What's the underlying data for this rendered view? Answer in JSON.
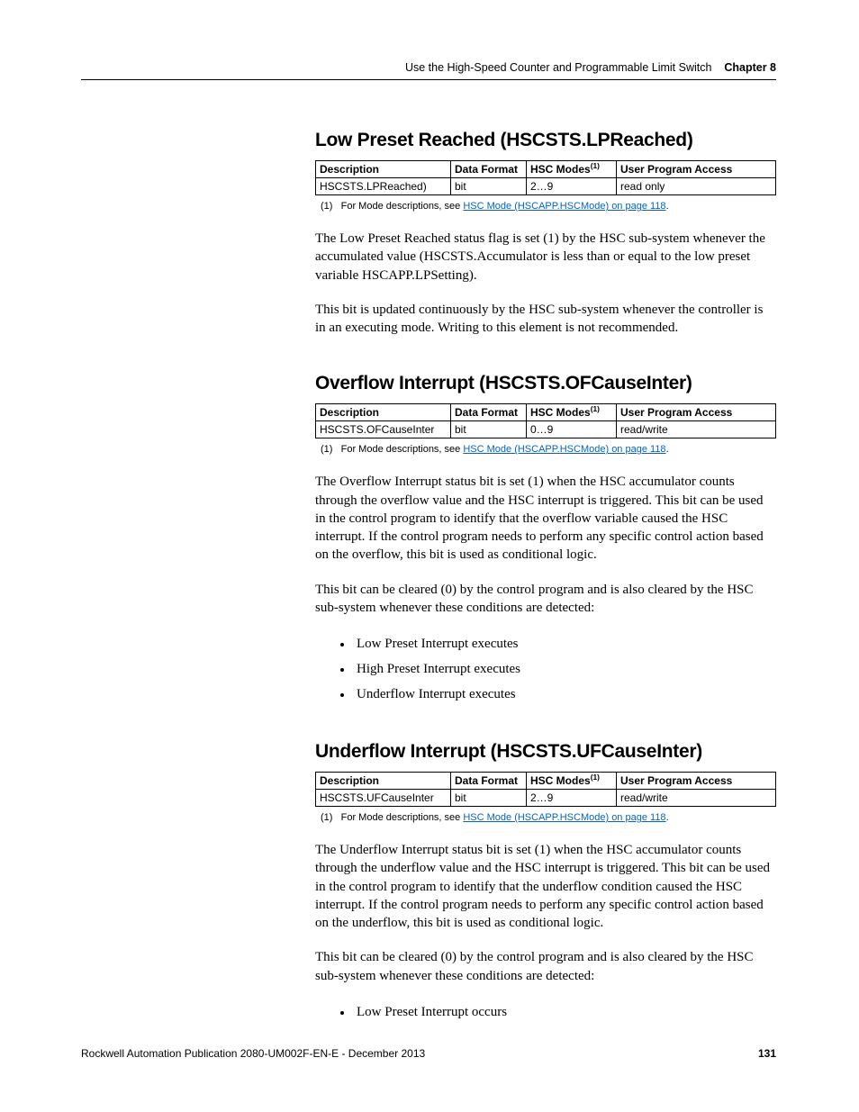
{
  "header": {
    "text_before": "Use the High-Speed Counter and Programmable Limit Switch",
    "chapter": "Chapter 8"
  },
  "sections": [
    {
      "heading": "Low Preset Reached (HSCSTS.LPReached)",
      "table": {
        "headers": {
          "c1": "Description",
          "c2": "Data Format",
          "c3_pre": "HSC Modes",
          "c3_sup": "(1)",
          "c4": "User Program Access"
        },
        "row": {
          "c1": "HSCSTS.LPReached)",
          "c2": "bit",
          "c3": "2…9",
          "c4": "read only"
        }
      },
      "footnote": {
        "prefix": "(1)   For Mode descriptions, see ",
        "link": "HSC Mode (HSCAPP.HSCMode) on page 118",
        "suffix": "."
      },
      "paras": [
        "The Low Preset Reached status flag is set (1) by the HSC sub-system whenever the accumulated value (HSCSTS.Accumulator is less than or equal to the low preset variable HSCAPP.LPSetting).",
        "This bit is updated continuously by the HSC sub-system whenever the controller is in an executing mode. Writing to this element is not recommended."
      ]
    },
    {
      "heading": "Overflow Interrupt (HSCSTS.OFCauseInter)",
      "table": {
        "headers": {
          "c1": "Description",
          "c2": "Data Format",
          "c3_pre": "HSC Modes",
          "c3_sup": "(1)",
          "c4": "User Program Access"
        },
        "row": {
          "c1": "HSCSTS.OFCauseInter",
          "c2": "bit",
          "c3": "0…9",
          "c4": "read/write"
        }
      },
      "footnote": {
        "prefix": "(1)   For Mode descriptions, see ",
        "link": "HSC Mode (HSCAPP.HSCMode) on page 118",
        "suffix": "."
      },
      "paras": [
        "The Overflow Interrupt status bit is set (1) when the HSC accumulator counts through the overflow value and the HSC interrupt is triggered. This bit can be used in the control program to identify that the overflow variable caused the HSC interrupt. If the control program needs to perform any specific control action based on the overflow, this bit is used as conditional logic.",
        "This bit can be cleared (0) by the control program and is also cleared by the HSC sub-system whenever these conditions are detected:"
      ],
      "list": [
        "Low Preset Interrupt executes",
        "High Preset Interrupt executes",
        "Underflow Interrupt executes"
      ]
    },
    {
      "heading": "Underflow Interrupt (HSCSTS.UFCauseInter)",
      "table": {
        "headers": {
          "c1": "Description",
          "c2": "Data Format",
          "c3_pre": "HSC Modes",
          "c3_sup": "(1)",
          "c4": "User Program Access"
        },
        "row": {
          "c1": "HSCSTS.UFCauseInter",
          "c2": "bit",
          "c3": "2…9",
          "c4": "read/write"
        }
      },
      "footnote": {
        "prefix": "(1)   For Mode descriptions, see ",
        "link": "HSC Mode (HSCAPP.HSCMode) on page 118",
        "suffix": "."
      },
      "paras": [
        "The Underflow Interrupt status bit is set (1) when the HSC accumulator counts through the underflow value and the HSC interrupt is triggered. This bit can be used in the control program to identify that the underflow condition caused the HSC interrupt. If the control program needs to perform any specific control action based on the underflow, this bit is used as conditional logic.",
        "This bit can be cleared (0) by the control program and is also cleared by the HSC sub-system whenever these conditions are detected:"
      ],
      "list": [
        "Low Preset Interrupt occurs"
      ]
    }
  ],
  "footer": {
    "pub": "Rockwell Automation Publication 2080-UM002F-EN-E - December 2013",
    "page": "131"
  }
}
